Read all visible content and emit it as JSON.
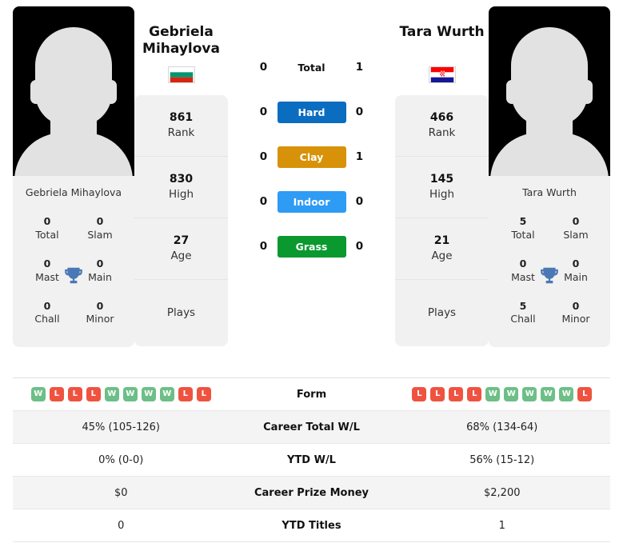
{
  "players": {
    "left": {
      "name": "Gebriela Mihaylova",
      "name_line1": "Gebriela",
      "name_line2": "Mihaylova",
      "country": "Bulgaria",
      "flag_icon": "flag-bulgaria",
      "avatar_icon": "player-placeholder-avatar",
      "titles": [
        {
          "value": "0",
          "label": "Total"
        },
        {
          "value": "0",
          "label": "Slam"
        },
        {
          "value": "0",
          "label": "Mast"
        },
        {
          "value": "0",
          "label": "Main"
        },
        {
          "value": "0",
          "label": "Chall"
        },
        {
          "value": "0",
          "label": "Minor"
        }
      ],
      "stats": [
        {
          "value": "861",
          "label": "Rank"
        },
        {
          "value": "830",
          "label": "High"
        },
        {
          "value": "27",
          "label": "Age"
        },
        {
          "value": "",
          "label": "Plays"
        }
      ],
      "form": [
        "W",
        "L",
        "L",
        "L",
        "W",
        "W",
        "W",
        "W",
        "L",
        "L"
      ]
    },
    "right": {
      "name": "Tara Wurth",
      "name_line1": "Tara Wurth",
      "name_line2": "",
      "country": "Croatia",
      "flag_icon": "flag-croatia",
      "avatar_icon": "player-placeholder-avatar",
      "titles": [
        {
          "value": "5",
          "label": "Total"
        },
        {
          "value": "0",
          "label": "Slam"
        },
        {
          "value": "0",
          "label": "Mast"
        },
        {
          "value": "0",
          "label": "Main"
        },
        {
          "value": "5",
          "label": "Chall"
        },
        {
          "value": "0",
          "label": "Minor"
        }
      ],
      "stats": [
        {
          "value": "466",
          "label": "Rank"
        },
        {
          "value": "145",
          "label": "High"
        },
        {
          "value": "21",
          "label": "Age"
        },
        {
          "value": "",
          "label": "Plays"
        }
      ],
      "form": [
        "L",
        "L",
        "L",
        "L",
        "W",
        "W",
        "W",
        "W",
        "W",
        "L"
      ]
    }
  },
  "head_to_head": [
    {
      "label": "Total",
      "left": "0",
      "right": "1",
      "style": "plain",
      "color": ""
    },
    {
      "label": "Hard",
      "left": "0",
      "right": "0",
      "style": "chip",
      "color": "#0b6dc0"
    },
    {
      "label": "Clay",
      "left": "0",
      "right": "1",
      "style": "chip",
      "color": "#d89209"
    },
    {
      "label": "Indoor",
      "left": "0",
      "right": "0",
      "style": "chip",
      "color": "#2e9bf5"
    },
    {
      "label": "Grass",
      "left": "0",
      "right": "0",
      "style": "chip",
      "color": "#09992e"
    }
  ],
  "comparison_rows": [
    {
      "label": "Form",
      "left": "",
      "right": "",
      "type": "form",
      "alt": false
    },
    {
      "label": "Career Total W/L",
      "left": "45% (105-126)",
      "right": "68% (134-64)",
      "type": "text",
      "alt": true
    },
    {
      "label": "YTD W/L",
      "left": "0% (0-0)",
      "right": "56% (15-12)",
      "type": "text",
      "alt": false
    },
    {
      "label": "Career Prize Money",
      "left": "$0",
      "right": "$2,200",
      "type": "text",
      "alt": true
    },
    {
      "label": "YTD Titles",
      "left": "0",
      "right": "1",
      "type": "text",
      "alt": false
    }
  ],
  "colors": {
    "hard": "#0b6dc0",
    "clay": "#d89209",
    "indoor": "#2e9bf5",
    "grass": "#09992e",
    "win": "#6dbf87",
    "loss": "#ef5340",
    "trophy": "#4a78b5"
  },
  "icons": {
    "trophy": "trophy-icon"
  }
}
